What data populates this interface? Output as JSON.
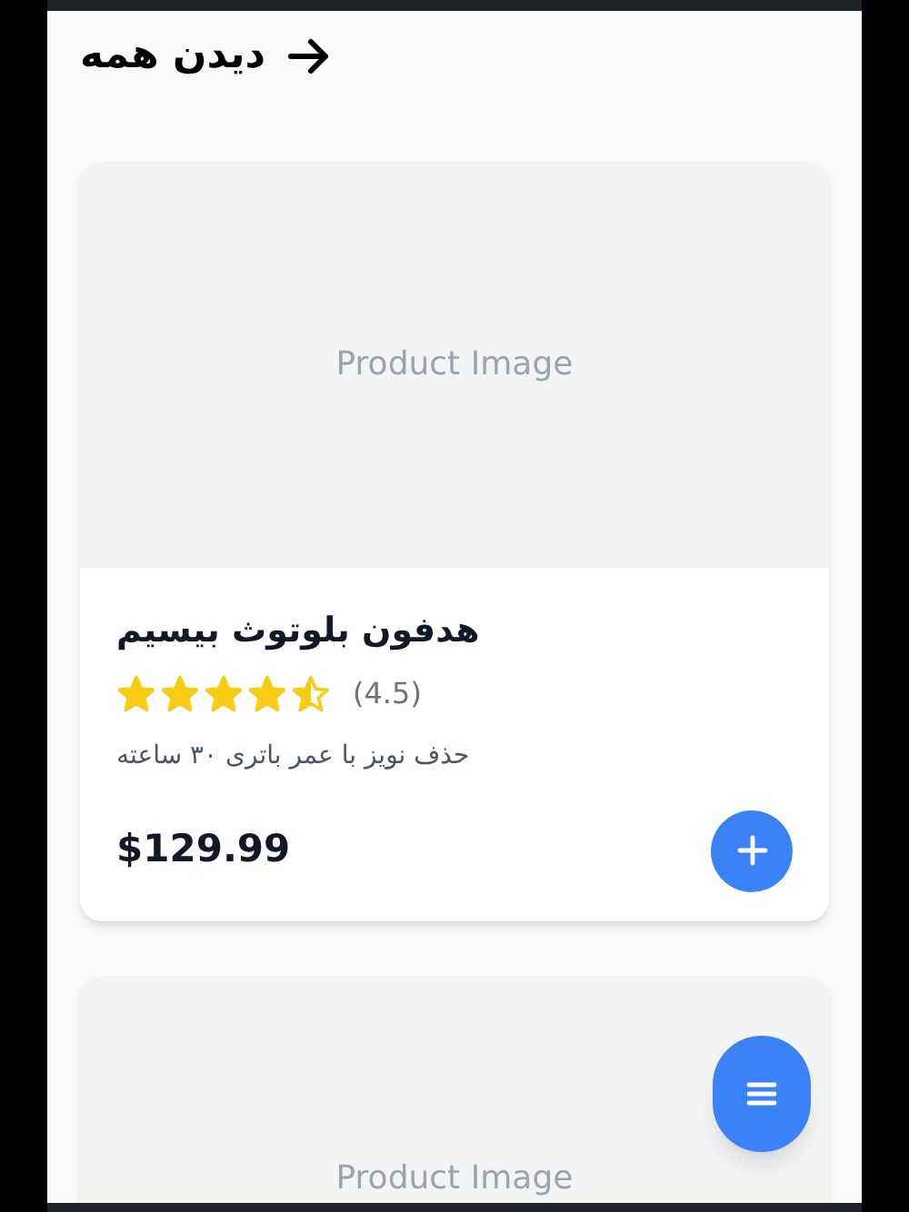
{
  "header": {
    "see_all": "دیدن همه"
  },
  "products": [
    {
      "image_label": "Product Image",
      "title": "هدفون بلوتوث بیسیم",
      "stars": 4.5,
      "rating": "(4.5)",
      "description": "حذف نویز با عمر باتری ۳۰ ساعته",
      "price": "$129.99"
    },
    {
      "image_label": "Product Image"
    }
  ]
}
